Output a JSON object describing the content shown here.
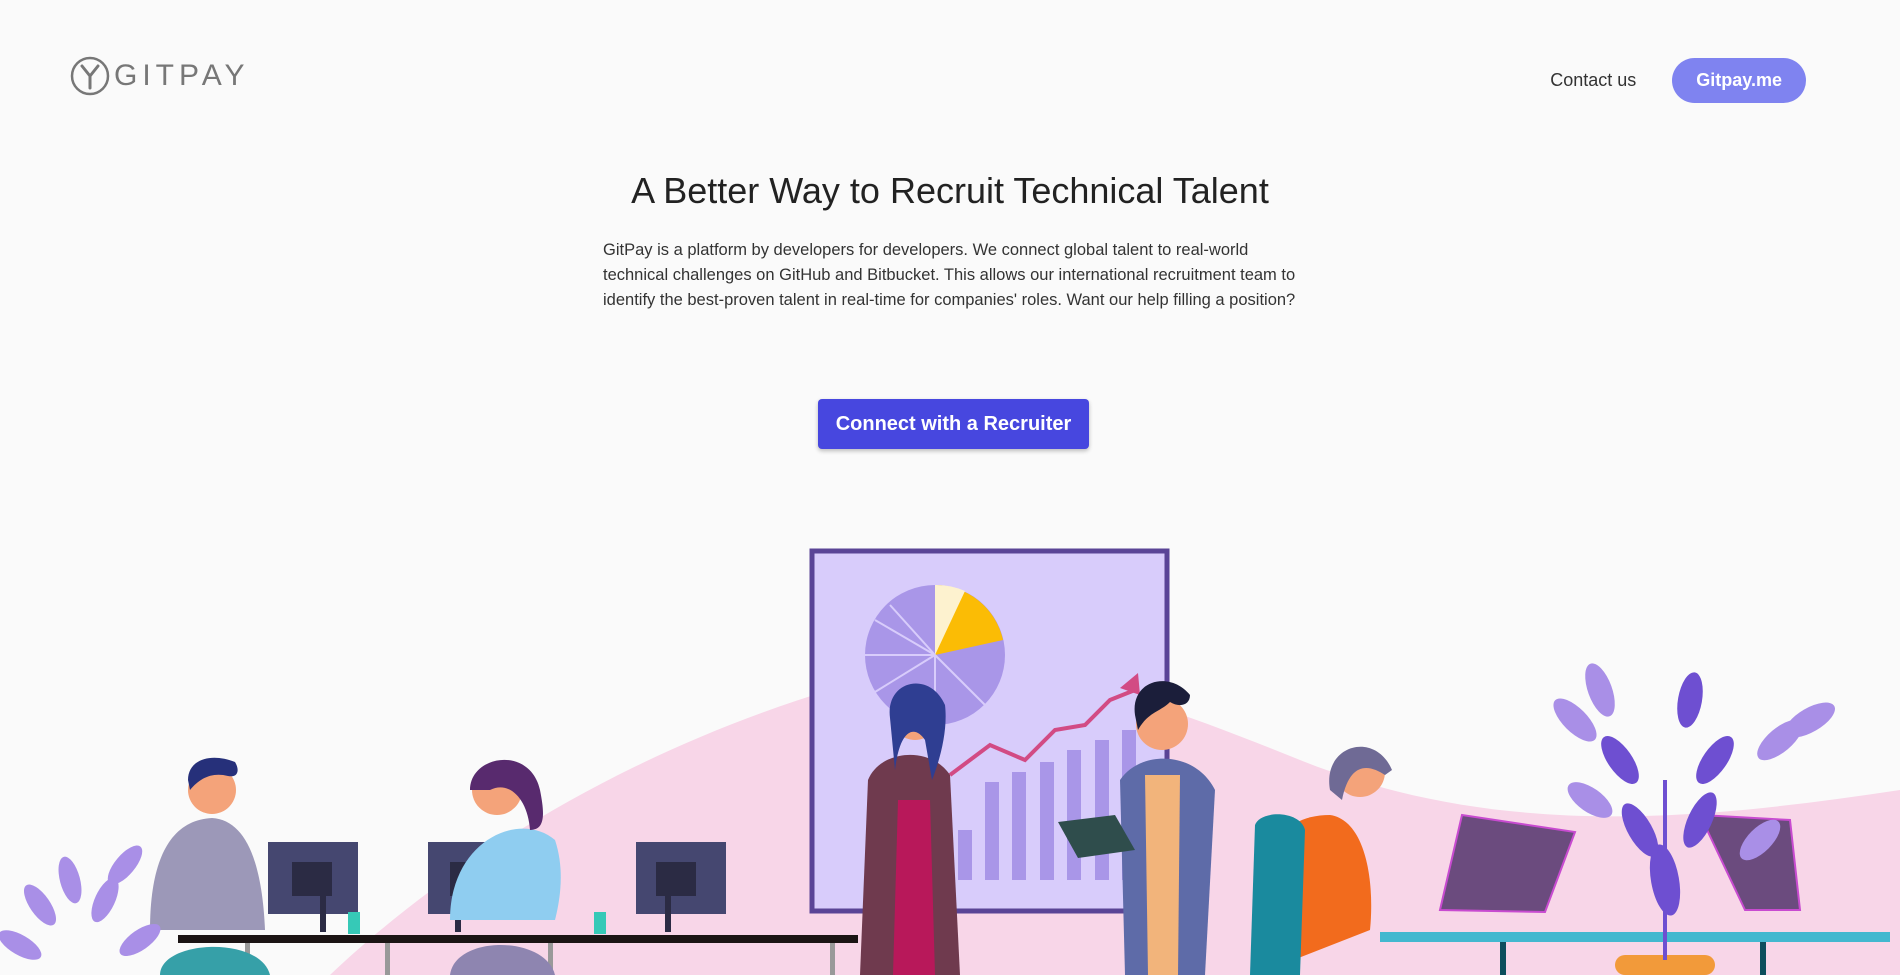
{
  "header": {
    "logo_text": "GITPAY",
    "logo_icon": "gitpay-logo-mark",
    "nav": {
      "contact_label": "Contact us",
      "gitpay_me_label": "Gitpay.me"
    }
  },
  "hero": {
    "title": "A Better Way to Recruit Technical Talent",
    "description": "GitPay is a platform by developers for developers. We connect global talent to real-world technical challenges on GitHub and Bitbucket. This allows our international recruitment team to identify the best-proven talent in real-time for companies' roles. Want our help filling a position?",
    "cta_label": "Connect with a Recruiter"
  },
  "colors": {
    "accent": "#4747df",
    "secondary_button": "#7f83f0",
    "background": "#fafafa",
    "illustration_purple": "#8b6fdc",
    "illustration_pink": "#f8d6e8"
  }
}
